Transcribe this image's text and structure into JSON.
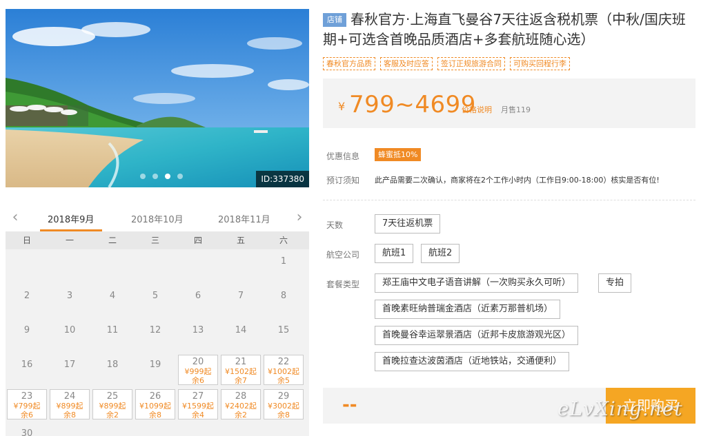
{
  "photo": {
    "id_label": "ID:337380"
  },
  "calendar": {
    "months": [
      "2018年9月",
      "2018年10月",
      "2018年11月"
    ],
    "weekdays": [
      "日",
      "一",
      "二",
      "三",
      "四",
      "五",
      "六"
    ],
    "cells": [
      {
        "d": ""
      },
      {
        "d": ""
      },
      {
        "d": ""
      },
      {
        "d": ""
      },
      {
        "d": ""
      },
      {
        "d": ""
      },
      {
        "d": "1"
      },
      {
        "d": "2"
      },
      {
        "d": "3"
      },
      {
        "d": "4"
      },
      {
        "d": "5"
      },
      {
        "d": "6"
      },
      {
        "d": "7"
      },
      {
        "d": "8"
      },
      {
        "d": "9"
      },
      {
        "d": "10"
      },
      {
        "d": "11"
      },
      {
        "d": "12"
      },
      {
        "d": "13"
      },
      {
        "d": "14"
      },
      {
        "d": "15"
      },
      {
        "d": "16"
      },
      {
        "d": "17"
      },
      {
        "d": "18"
      },
      {
        "d": "19"
      },
      {
        "d": "20",
        "p": "¥999起",
        "r": "余6"
      },
      {
        "d": "21",
        "p": "¥1502起",
        "r": "余7"
      },
      {
        "d": "22",
        "p": "¥1002起",
        "r": "余5"
      },
      {
        "d": "23",
        "p": "¥799起",
        "r": "余6"
      },
      {
        "d": "24",
        "p": "¥899起",
        "r": "余8"
      },
      {
        "d": "25",
        "p": "¥899起",
        "r": "余2"
      },
      {
        "d": "26",
        "p": "¥1099起",
        "r": "余8"
      },
      {
        "d": "27",
        "p": "¥1599起",
        "r": "余4"
      },
      {
        "d": "28",
        "p": "¥2402起",
        "r": "余2"
      },
      {
        "d": "29",
        "p": "¥3002起",
        "r": "余8"
      },
      {
        "d": "30"
      }
    ]
  },
  "product": {
    "shop_badge": "店铺",
    "title": "春秋官方·上海直飞曼谷7天往返含税机票（中秋/国庆班期+可选含首晚品质酒店+多套航班随心选）",
    "tags": [
      "春秋官方品质",
      "客服及时应答",
      "签订正规旅游合同",
      "可购买回程行李"
    ],
    "price_yen": "¥",
    "price": "799~4699",
    "price_note": "价格说明",
    "sales": "月售119"
  },
  "info": {
    "promo_label": "优惠信息",
    "promo_badge": "蜂蜜抵10%",
    "notice_label": "预订须知",
    "notice": "此产品需要二次确认，商家将在2个工作小时内（工作日9:00-18:00）核实是否有位!"
  },
  "options": {
    "days_label": "天数",
    "days": [
      "7天往返机票"
    ],
    "airline_label": "航空公司",
    "airlines": [
      "航班1",
      "航班2"
    ],
    "package_label": "套餐类型",
    "packages": [
      "郑王庙中文电子语音讲解（一次购买永久可听）",
      "专拍",
      "首晚素旺纳普瑞金酒店（近素万那普机场）",
      "首晚曼谷幸运翠景酒店（近邦卡皮旅游观光区）",
      "首晚拉查达波茵酒店（近地铁站，交通便利）"
    ]
  },
  "buy": {
    "total": "--",
    "button": "立即购买"
  },
  "watermark": "eLvXing.net",
  "colors": {
    "accent": "#f08a24",
    "button": "#f5a623",
    "shop_badge": "#6fa0d8"
  }
}
